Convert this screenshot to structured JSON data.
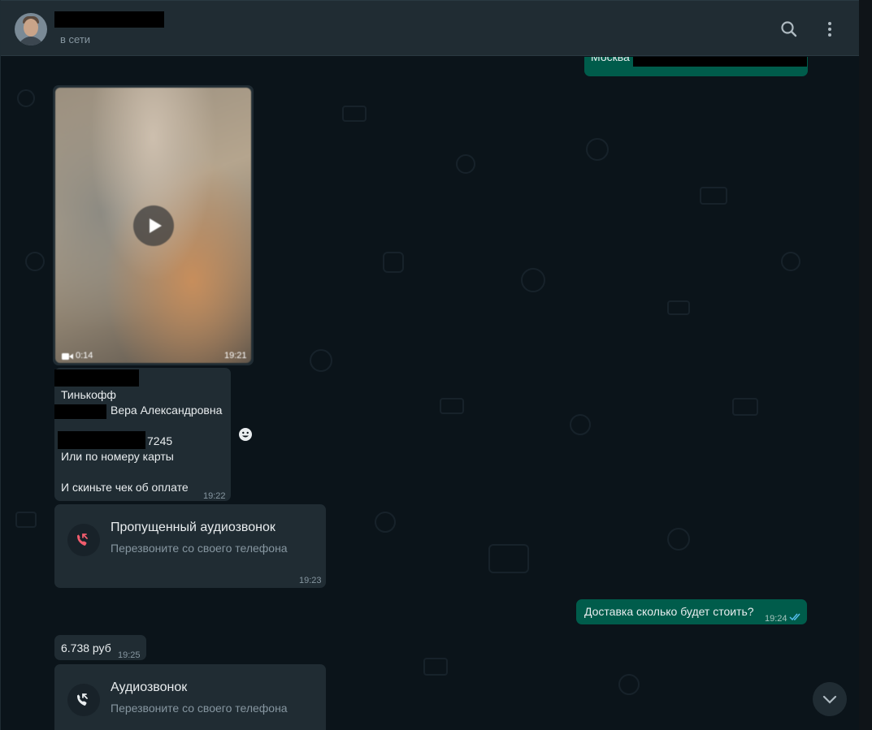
{
  "header": {
    "status": "в сети",
    "search_icon": "search-icon",
    "menu_icon": "kebab-menu-icon"
  },
  "messages": {
    "top_outgoing": {
      "text": "Москва"
    },
    "video": {
      "duration": "0:14",
      "time": "19:21"
    },
    "payment": {
      "line1": "Тинькофф",
      "line2": "Вера Александровна",
      "line3": "7245",
      "line4": "Или по номеру карты",
      "line5": "И скиньте чек об оплате",
      "time": "19:22"
    },
    "missed_call": {
      "title": "Пропущенный аудиозвонок",
      "subtitle": "Перезвоните со своего телефона",
      "time": "19:23"
    },
    "delivery_question": {
      "text": "Доставка сколько будет стоить?",
      "time": "19:24"
    },
    "price": {
      "text": "6.738 руб",
      "time": "19:25"
    },
    "audio_call": {
      "title": "Аудиозвонок",
      "subtitle": "Перезвоните со своего телефона"
    }
  },
  "colors": {
    "chat_bg": "#0b141a",
    "incoming_bubble": "#202c33",
    "outgoing_bubble": "#005c4b",
    "missed_call_red": "#f15c6d",
    "read_ticks": "#53bdeb"
  }
}
